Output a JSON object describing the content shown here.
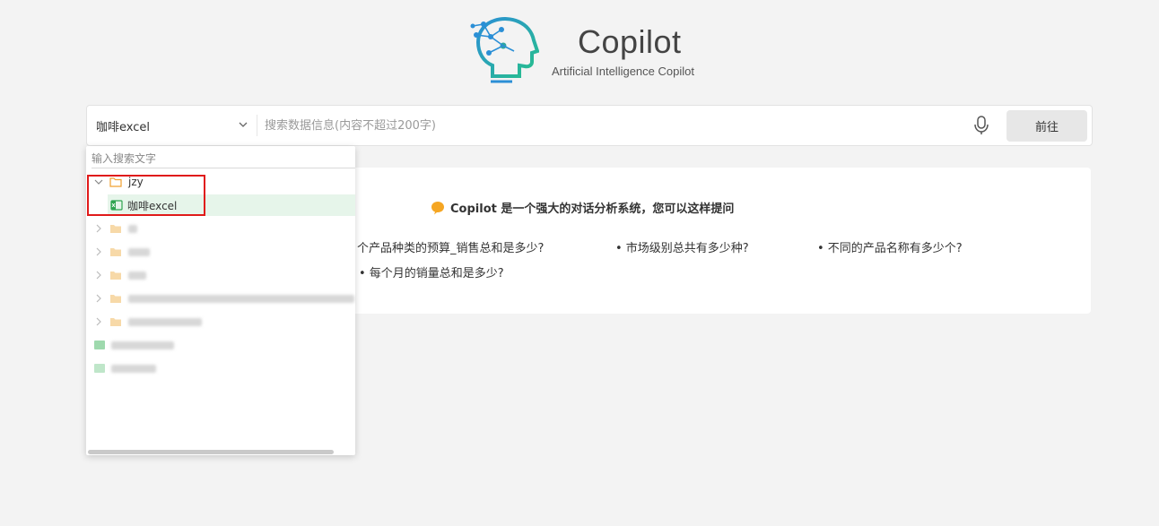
{
  "app": {
    "title": "Copilot",
    "subtitle": "Artificial Intelligence Copilot"
  },
  "search": {
    "datasource_value": "咖啡excel",
    "query_placeholder": "搜索数据信息(内容不超过200字)",
    "submit_label": "前往"
  },
  "suggestions": {
    "title": "Copilot 是一个强大的对话分析系统，您可以这样提问",
    "items": [
      "个产品种类的预算_销售总和是多少?",
      "• 市场级别总共有多少种?",
      "• 不同的产品名称有多少个?",
      "• 每个月的销量总和是多少?"
    ]
  },
  "dropdown": {
    "search_placeholder": "输入搜索文字",
    "tree": [
      {
        "type": "folder",
        "label": "jzy",
        "expanded": true
      },
      {
        "type": "file",
        "label": "咖啡excel",
        "selected": true
      },
      {
        "type": "folder",
        "label": ""
      },
      {
        "type": "folder",
        "label": ""
      },
      {
        "type": "folder",
        "label": ""
      },
      {
        "type": "folder",
        "label": ""
      },
      {
        "type": "folder",
        "label": ""
      },
      {
        "type": "file",
        "label": ""
      },
      {
        "type": "file",
        "label": ""
      }
    ]
  },
  "colors": {
    "accent_green": "#2ea44f",
    "folder_orange": "#f0a030",
    "highlight_red": "#e01a1a",
    "selected_bg": "#e6f5ea"
  }
}
